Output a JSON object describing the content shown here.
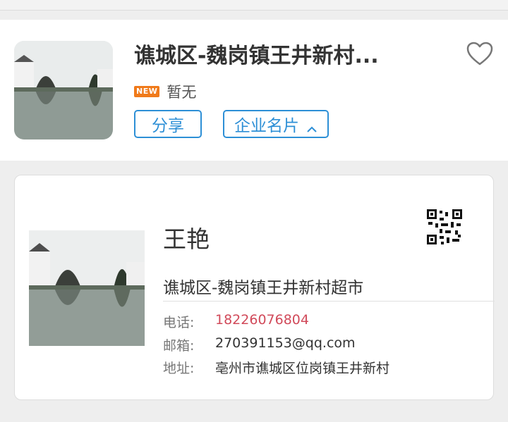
{
  "header": {
    "title": "谯城区-魏岗镇王井新村...",
    "badge": "NEW",
    "subtitle": "暂无",
    "share_label": "分享",
    "card_label": "企业名片",
    "favorite_icon": "heart-outline-icon",
    "chevron_icon": "chevron-up-icon"
  },
  "card": {
    "name": "王艳",
    "company": "谯城区-魏岗镇王井新村超市",
    "qr_icon": "qr-code-icon",
    "phone_label": "电话:",
    "phone": "18226076804",
    "email_label": "邮箱:",
    "email": "270391153@qq.com",
    "address_label": "地址:",
    "address": "亳州市谯城区位岗镇王井新村"
  },
  "colors": {
    "accent": "#2d8fd6",
    "badge": "#f07a1a",
    "phone": "#d14a5a"
  }
}
